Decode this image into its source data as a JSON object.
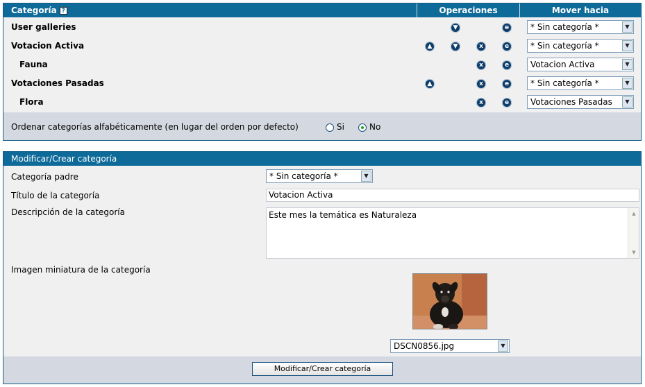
{
  "category_table": {
    "headers": {
      "category": "Categoría",
      "help_icon_glyph": "?",
      "operations": "Operaciones",
      "move_to": "Mover hacia"
    },
    "rows": [
      {
        "name": "User galleries",
        "move_value": "* Sin categoría *"
      },
      {
        "name": "Votacion Activa",
        "move_value": "* Sin categoría *"
      },
      {
        "name": "Fauna",
        "move_value": "Votacion Activa"
      },
      {
        "name": "Votaciones Pasadas",
        "move_value": "* Sin categoría *"
      },
      {
        "name": "Flora",
        "move_value": "Votaciones Pasadas"
      }
    ],
    "icons": {
      "up": "▲",
      "down": "▼",
      "delete": "x",
      "edit": "e"
    },
    "sort": {
      "label": "Ordenar categorías alfabéticamente (en lugar del orden por defecto)",
      "yes": "Si",
      "no": "No",
      "selected": "No"
    }
  },
  "edit_form": {
    "title": "Modificar/Crear categoría",
    "parent_label": "Categoría padre",
    "parent_value": "* Sin categoría *",
    "title_label": "Título de la categoría",
    "title_value": "Votacion Activa",
    "description_label": "Descripción de la categoría",
    "description_value": "Este mes la temática es Naturaleza",
    "thumbnail_label": "Imagen miniatura de la categoría",
    "thumbnail_file": "DSCN0856.jpg",
    "submit_label": "Modificar/Crear categoría"
  },
  "colors": {
    "header_bg": "#0e6a99",
    "panel_bg": "#f0f0f0",
    "footer_bg": "#d4d8e0",
    "icon_bg": "#0e3d6a"
  }
}
